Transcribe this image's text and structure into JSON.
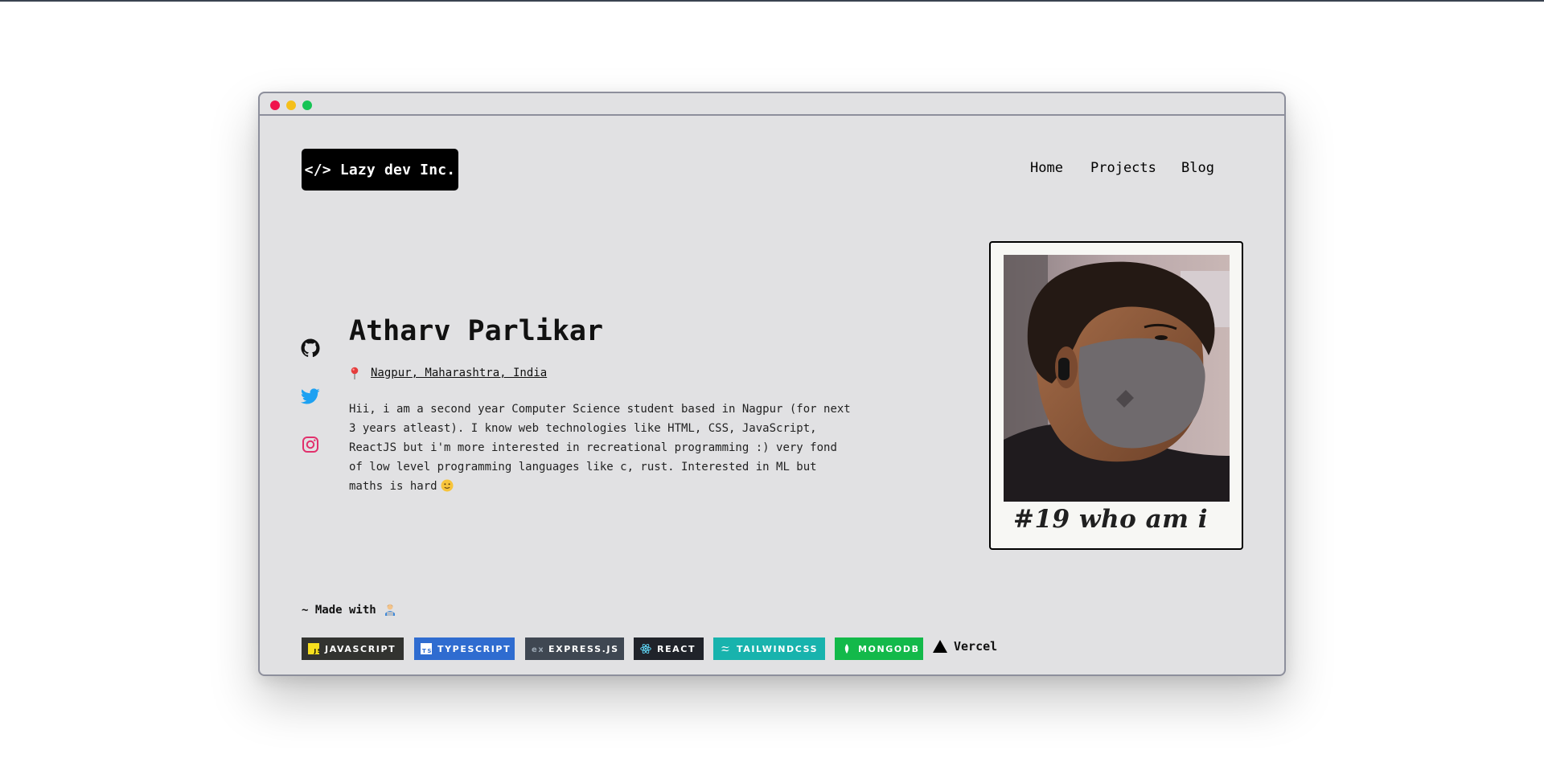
{
  "window": {
    "controls": [
      "close",
      "minimize",
      "maximize"
    ]
  },
  "header": {
    "logo": "</> Lazy dev Inc.",
    "nav": [
      {
        "label": "Home"
      },
      {
        "label": "Projects"
      },
      {
        "label": "Blog"
      }
    ]
  },
  "social": [
    {
      "icon": "github-icon",
      "color": "#111111"
    },
    {
      "icon": "twitter-icon",
      "color": "#1da1f2"
    },
    {
      "icon": "instagram-icon",
      "color": "#e1306c"
    }
  ],
  "profile": {
    "name": "Atharv Parlikar",
    "location": "Nagpur, Maharashtra, India",
    "bio": "Hii, i am a second year Computer Science student based in Nagpur (for next 3 years atleast). I know web technologies like HTML, CSS, JavaScript, ReactJS but i'm more interested in recreational programming :) very fond of low level programming languages like c, rust. Interested in ML but maths is hard",
    "photo_caption": "#19 who am i"
  },
  "footer": {
    "made_with": "~ Made with",
    "badges": [
      {
        "label": "JAVASCRIPT",
        "color": "#323330"
      },
      {
        "label": "TYPESCRIPT",
        "color": "#2f6cd0"
      },
      {
        "label": "EXPRESS.JS",
        "color": "#3f4752"
      },
      {
        "label": "REACT",
        "color": "#20232a"
      },
      {
        "label": "TAILWINDCSS",
        "color": "#18b3ad"
      },
      {
        "label": "MONGODB",
        "color": "#13b94a"
      }
    ],
    "hosting": "Vercel"
  },
  "colors": {
    "window_bg": "#e1e1e3",
    "window_border": "#8d8f9c",
    "close": "#f0134d",
    "minimize": "#f5bf1a",
    "maximize": "#16c455"
  }
}
